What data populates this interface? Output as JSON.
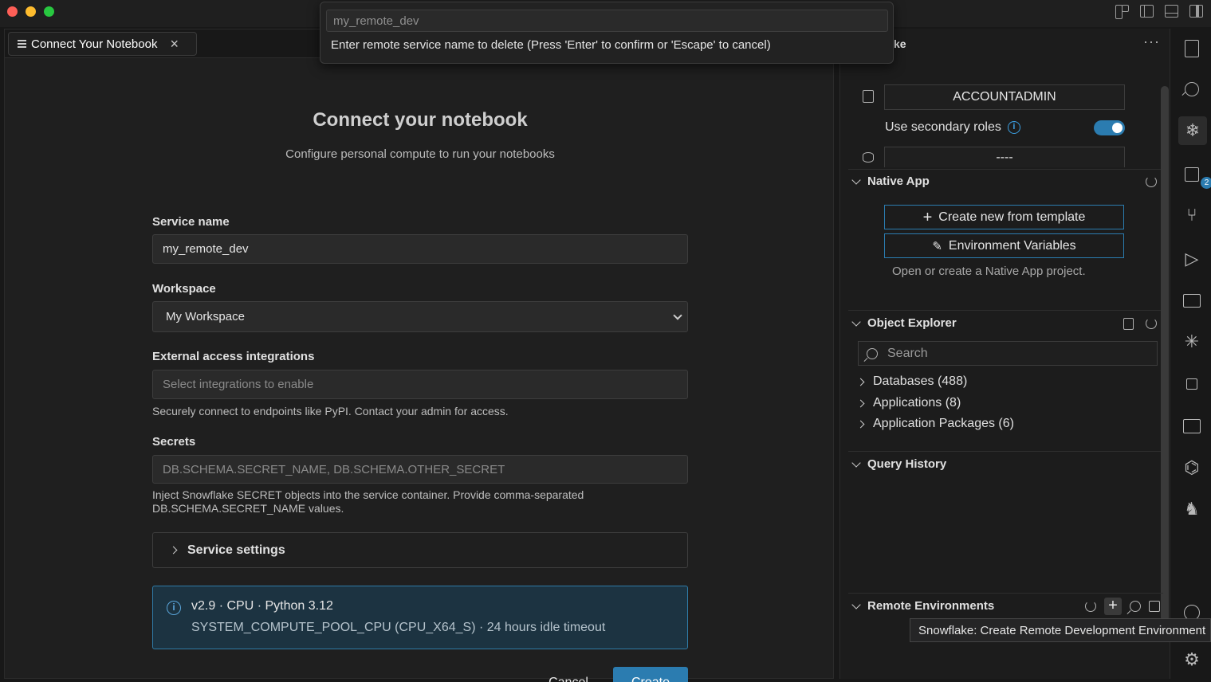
{
  "tab": {
    "label": "Connect Your Notebook"
  },
  "quick_input": {
    "value": "my_remote_dev",
    "message": "Enter remote service name to delete (Press 'Enter' to confirm or 'Escape' to cancel)"
  },
  "form": {
    "title": "Connect your notebook",
    "subtitle": "Configure personal compute to run your notebooks",
    "service_name_label": "Service name",
    "service_name_value": "my_remote_dev",
    "workspace_label": "Workspace",
    "workspace_value": "My Workspace",
    "eai_label": "External access integrations",
    "eai_placeholder": "Select integrations to enable",
    "eai_help": "Securely connect to endpoints like PyPI. Contact your admin for access.",
    "secrets_label": "Secrets",
    "secrets_placeholder": "DB.SCHEMA.SECRET_NAME, DB.SCHEMA.OTHER_SECRET",
    "secrets_help_1": "Inject Snowflake SECRET objects into the service container. Provide comma-separated",
    "secrets_help_2": "DB.SCHEMA.SECRET_NAME values.",
    "service_settings_label": "Service settings",
    "info_line1": "v2.9 · CPU · Python 3.12",
    "info_line2": "SYSTEM_COMPUTE_POOL_CPU (CPU_X64_S) · 24 hours idle timeout",
    "cancel_label": "Cancel",
    "create_label": "Create"
  },
  "side": {
    "header_fragment": "ke",
    "more_label": "···",
    "role": "ACCOUNTADMIN",
    "secondary_roles_label": "Use secondary roles",
    "secondary_roles_enabled": true,
    "warehouse_value": "----",
    "native_app": {
      "title": "Native App",
      "create_template_label": "Create new from template",
      "env_vars_label": "Environment Variables",
      "note": "Open or create a Native App project."
    },
    "object_explorer": {
      "title": "Object Explorer",
      "search_placeholder": "Search",
      "items": [
        {
          "label": "Databases (488)"
        },
        {
          "label": "Applications (8)"
        },
        {
          "label": "Application Packages (6)"
        }
      ]
    },
    "query_history": {
      "title": "Query History"
    },
    "remote_environments": {
      "title": "Remote Environments"
    },
    "tooltip": "Snowflake: Create Remote Development Environment"
  },
  "activity": {
    "extensions_badge": "2"
  },
  "colors": {
    "accent": "#2b7cb0",
    "info_bg": "#1c3341"
  }
}
